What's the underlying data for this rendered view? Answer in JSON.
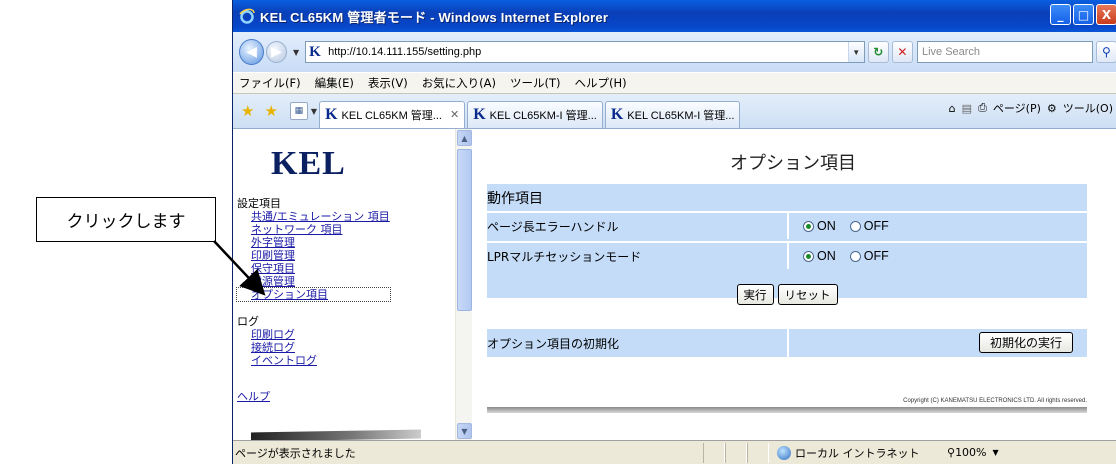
{
  "callout": {
    "text": "クリックします"
  },
  "window": {
    "title": "KEL CL65KM 管理者モード - Windows Internet Explorer",
    "buttons": {
      "minimize": "_",
      "maximize": "□",
      "close": "X"
    }
  },
  "address": {
    "url": "http://10.14.111.155/setting.php",
    "search_placeholder": "Live Search"
  },
  "menu": [
    "ファイル(F)",
    "編集(E)",
    "表示(V)",
    "お気に入り(A)",
    "ツール(T)",
    "ヘルプ(H)"
  ],
  "tabs": [
    {
      "label": "KEL CL65KM 管理...",
      "active": true
    },
    {
      "label": "KEL CL65KM-I 管理...",
      "active": false
    },
    {
      "label": "KEL CL65KM-I 管理...",
      "active": false
    }
  ],
  "tabtools": {
    "page": "ページ(P)",
    "tools": "ツール(O)"
  },
  "left": {
    "logo": "KEL",
    "settings_heading": "設定項目",
    "settings_links": [
      "共通/エミュレーション 項目",
      "ネットワーク 項目",
      "外字管理",
      "印刷管理",
      "保守項目",
      "電源管理",
      "オプション項目"
    ],
    "log_heading": "ログ",
    "log_links": [
      "印刷ログ",
      "接続ログ",
      "イベントログ"
    ],
    "help": "ヘルプ"
  },
  "main": {
    "title": "オプション項目",
    "section": "動作項目",
    "rows": [
      {
        "label": "ページ長エラーハンドル",
        "on": "ON",
        "off": "OFF",
        "selected": "ON"
      },
      {
        "label": "LPRマルチセッションモード",
        "on": "ON",
        "off": "OFF",
        "selected": "ON"
      }
    ],
    "execute": "実行",
    "reset": "リセット",
    "init_label": "オプション項目の初期化",
    "init_button": "初期化の実行",
    "copyright": "Copyright (C) KANEMATSU ELECTRONICS LTD. All rights reserved."
  },
  "status": {
    "text": "ページが表示されました",
    "zone": "ローカル イントラネット",
    "zoom": "100%"
  }
}
